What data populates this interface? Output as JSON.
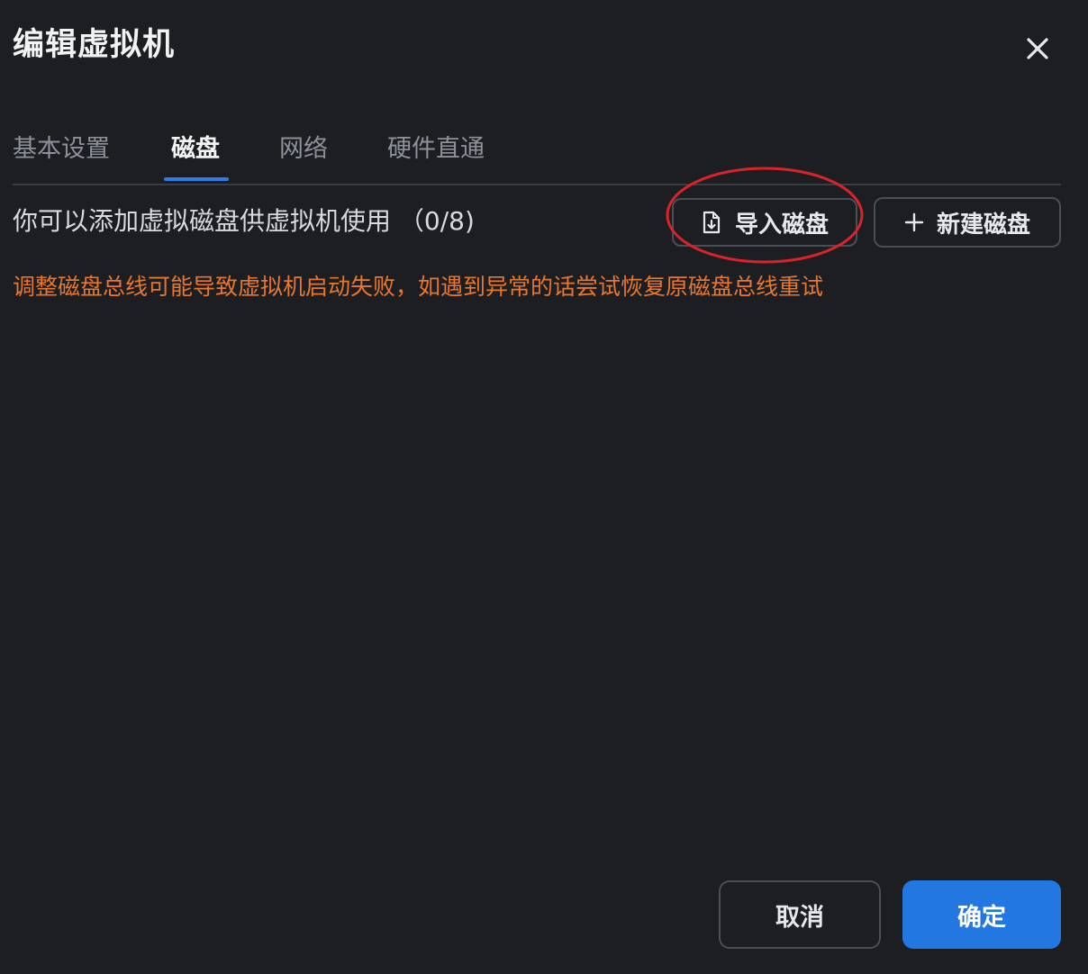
{
  "dialog": {
    "title": "编辑虚拟机",
    "close_icon": "close-icon"
  },
  "tabs": [
    {
      "label": "基本设置",
      "active": false
    },
    {
      "label": "磁盘",
      "active": true
    },
    {
      "label": "网络",
      "active": false
    },
    {
      "label": "硬件直通",
      "active": false
    }
  ],
  "disk": {
    "description": "你可以添加虚拟磁盘供虚拟机使用 （0/8)",
    "import_label": "导入磁盘",
    "import_icon": "file-import-icon",
    "new_label": "新建磁盘",
    "new_icon": "plus-icon",
    "warning": "调整磁盘总线可能导致虚拟机启动失败，如遇到异常的话尝试恢复原磁盘总线重试"
  },
  "footer": {
    "cancel_label": "取消",
    "ok_label": "确定"
  },
  "colors": {
    "background": "#1c1e22",
    "accent": "#2277e0",
    "warning": "#e8772e",
    "annotation": "#d9232a"
  }
}
